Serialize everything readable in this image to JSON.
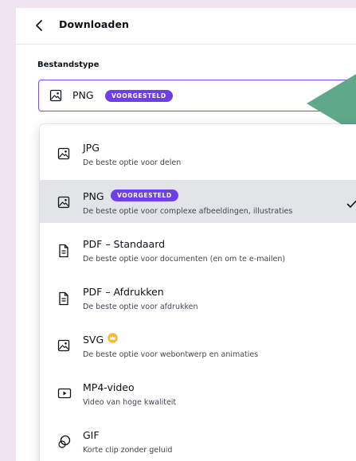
{
  "header": {
    "title": "Downloaden",
    "back_icon": "chevron-left-icon"
  },
  "file_type": {
    "label": "Bestandstype",
    "selected_value": "PNG",
    "selected_badge": "VOORGESTELD",
    "icon": "image-icon"
  },
  "colors": {
    "accent": "#8b3dff",
    "badge": "#6e3fe6",
    "pointer": "#5fa889",
    "selected_row": "#e3e4e7",
    "background": "#efe4ef",
    "crown": "#f5b82e"
  },
  "options": [
    {
      "title": "JPG",
      "description": "De beste optie voor delen",
      "icon": "image-icon"
    },
    {
      "title": "PNG",
      "badge": "VOORGESTELD",
      "description": "De beste optie voor complexe afbeeldingen, illustraties",
      "icon": "image-icon",
      "selected": true
    },
    {
      "title": "PDF – Standaard",
      "description": "De beste optie voor documenten (en om te e-mailen)",
      "icon": "document-icon"
    },
    {
      "title": "PDF – Afdrukken",
      "description": "De beste optie voor afdrukken",
      "icon": "document-icon"
    },
    {
      "title": "SVG",
      "description": "De beste optie voor webontwerp en animaties",
      "icon": "image-icon",
      "premium": "crown-icon"
    },
    {
      "title": "MP4-video",
      "description": "Video van hoge kwaliteit",
      "icon": "video-icon"
    },
    {
      "title": "GIF",
      "description": "Korte clip zonder geluid",
      "icon": "gif-icon"
    }
  ]
}
